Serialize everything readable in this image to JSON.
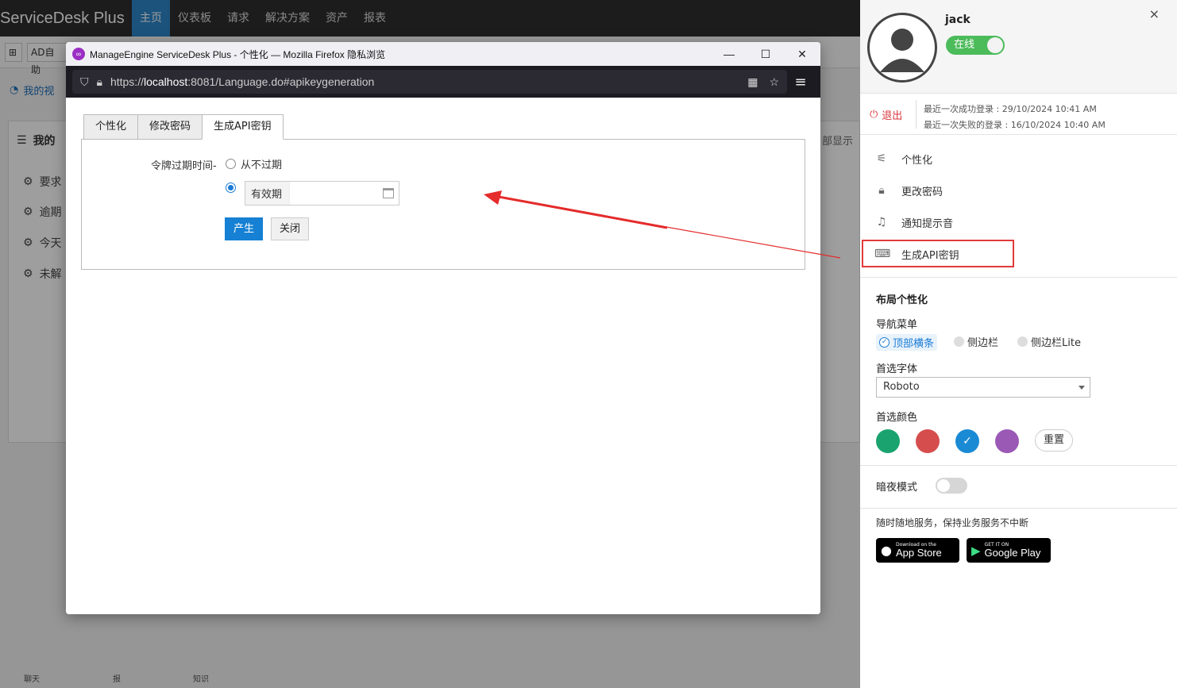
{
  "background_app": {
    "brand": "ServiceDesk Plus",
    "nav": [
      "主页",
      "仪表板",
      "请求",
      "解决方案",
      "资产",
      "报表"
    ],
    "subbar_label": "AD自助",
    "section_tab": "我的视",
    "panel_title": "我的",
    "panel_right": "部显示",
    "panel_items": [
      "要求",
      "逾期",
      "今天",
      "未解"
    ],
    "bottom_labels": [
      "聊天",
      "报",
      "知识"
    ]
  },
  "firefox": {
    "title": "ManageEngine ServiceDesk Plus - 个性化 — Mozilla Firefox 隐私浏览",
    "url_prefix": "https://",
    "url_host": "localhost",
    "url_rest": ":8081/Language.do#apikeygeneration",
    "minimize": "—",
    "maximize": "☐",
    "close": "✕"
  },
  "page": {
    "tabs": [
      "个性化",
      "修改密码",
      "生成API密钥"
    ],
    "expire_label": "令牌过期时间-",
    "option_never": "从不过期",
    "option_validity": "有效期",
    "validity_value": "",
    "generate_button": "产生",
    "close_button": "关闭"
  },
  "user_panel": {
    "username": "jack",
    "status": "在线",
    "close": "×",
    "logout": "退出",
    "last_success_login": "最近一次成功登录 : 29/10/2024 10:41 AM",
    "last_failed_login": "最近一次失败的登录 : 16/10/2024 10:40 AM",
    "menu": [
      "个性化",
      "更改密码",
      "通知提示音",
      "生成API密钥"
    ],
    "layout_title": "布局个性化",
    "nav_menu_title": "导航菜单",
    "nav_options": [
      "顶部横条",
      "侧边栏",
      "侧边栏Lite"
    ],
    "font_title": "首选字体",
    "font_value": "Roboto",
    "color_title": "首选颜色",
    "colors": [
      "#1aa36f",
      "#d64d4d",
      "#1a8ad4",
      "#9b59b6"
    ],
    "reset": "重置",
    "dark_mode": "暗夜模式",
    "tagline": "随时随地服务，保持业务服务不中断",
    "app_store_small": "Download on the",
    "app_store_big": "App Store",
    "google_play_small": "GET IT ON",
    "google_play_big": "Google Play"
  }
}
